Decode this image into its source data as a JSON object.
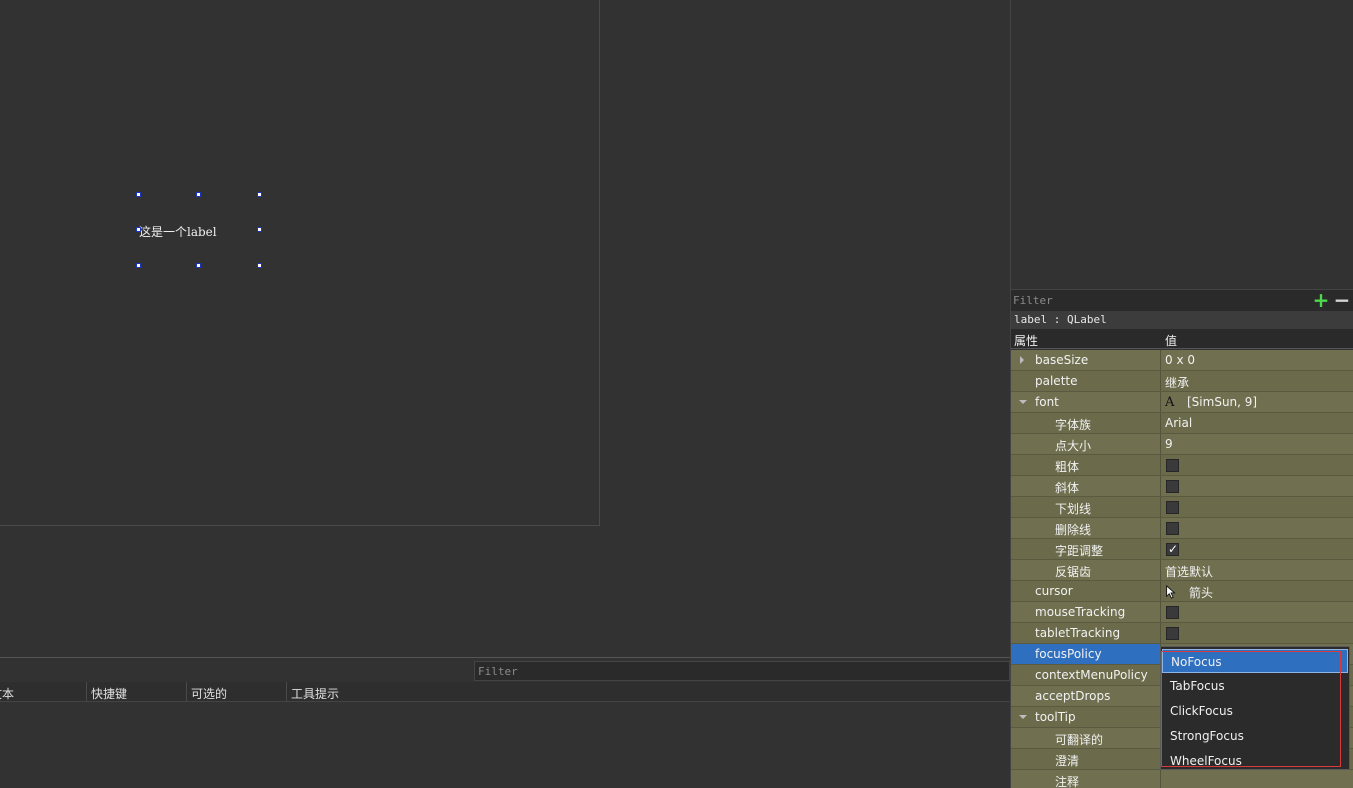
{
  "canvas": {
    "label_text": "这是一个label"
  },
  "action_editor": {
    "filter_placeholder": "Filter",
    "columns": [
      "文本",
      "快捷键",
      "可选的",
      "工具提示"
    ]
  },
  "property_editor": {
    "filter_placeholder": "Filter",
    "add_icon": "plus-icon",
    "remove_icon": "minus-icon",
    "object_class": "label : QLabel",
    "header_property": "属性",
    "header_value": "值",
    "rows": [
      {
        "name": "baseSize",
        "value": "0 x 0",
        "expander": "collapsed"
      },
      {
        "name": "palette",
        "value": "继承"
      },
      {
        "name": "font",
        "value": "[SimSun, 9]",
        "expander": "expanded",
        "icon": "font-icon",
        "icon_glyph": "A"
      },
      {
        "name": "字体族",
        "value": "Arial",
        "sub": true
      },
      {
        "name": "点大小",
        "value": "9",
        "sub": true
      },
      {
        "name": "粗体",
        "checkbox": false,
        "sub": true
      },
      {
        "name": "斜体",
        "checkbox": false,
        "sub": true
      },
      {
        "name": "下划线",
        "checkbox": false,
        "sub": true
      },
      {
        "name": "删除线",
        "checkbox": false,
        "sub": true
      },
      {
        "name": "字距调整",
        "checkbox": true,
        "sub": true
      },
      {
        "name": "反锯齿",
        "value": "首选默认",
        "sub": true
      },
      {
        "name": "cursor",
        "value": "箭头",
        "icon": "cursor-icon"
      },
      {
        "name": "mouseTracking",
        "checkbox": false
      },
      {
        "name": "tabletTracking",
        "checkbox": false
      },
      {
        "name": "focusPolicy",
        "value": "",
        "selected": true
      },
      {
        "name": "contextMenuPolicy",
        "value": ""
      },
      {
        "name": "acceptDrops",
        "value": ""
      },
      {
        "name": "toolTip",
        "value": "",
        "expander": "expanded"
      },
      {
        "name": "可翻译的",
        "value": "",
        "sub": true
      },
      {
        "name": "澄清",
        "value": "",
        "sub": true
      },
      {
        "name": "注释",
        "value": "",
        "sub": true
      }
    ]
  },
  "focus_dropdown": {
    "options": [
      "NoFocus",
      "TabFocus",
      "ClickFocus",
      "StrongFocus",
      "WheelFocus"
    ],
    "highlighted": "NoFocus"
  },
  "colors": {
    "background": "#323232",
    "property_row": "#706f4f",
    "selection": "#2f6fc0",
    "outline_red": "#d93a3a",
    "add_green": "#4dd84d",
    "handle_blue": "#1c35b8"
  }
}
